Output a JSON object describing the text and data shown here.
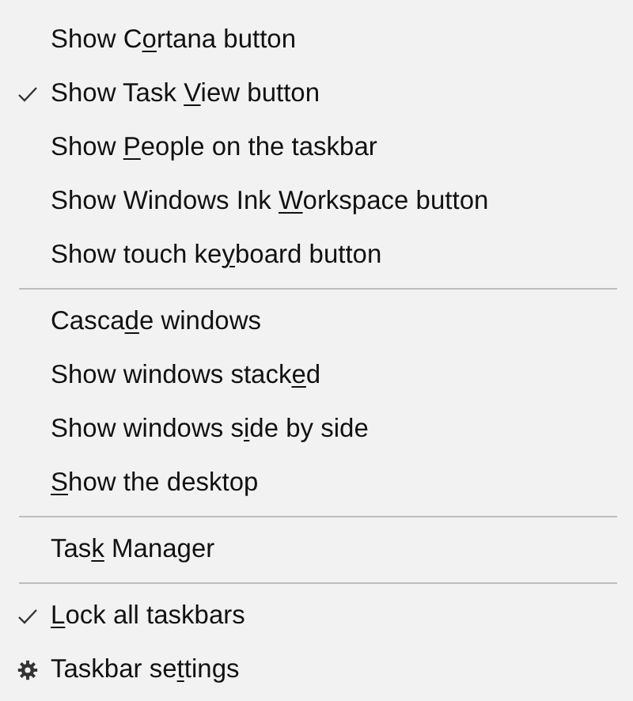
{
  "menu": {
    "entries": [
      {
        "kind": "item",
        "checked": false,
        "label": {
          "before": "Show C",
          "key": "o",
          "after": "rtana button"
        }
      },
      {
        "kind": "item",
        "checked": true,
        "label": {
          "before": "Show Task ",
          "key": "V",
          "after": "iew button"
        }
      },
      {
        "kind": "item",
        "checked": false,
        "label": {
          "before": "Show ",
          "key": "P",
          "after": "eople on the taskbar"
        }
      },
      {
        "kind": "item",
        "checked": false,
        "label": {
          "before": "Show Windows Ink ",
          "key": "W",
          "after": "orkspace button"
        }
      },
      {
        "kind": "item",
        "checked": false,
        "label": {
          "before": "Show touch ke",
          "key": "y",
          "after": "board button"
        }
      },
      {
        "kind": "separator"
      },
      {
        "kind": "item",
        "checked": false,
        "label": {
          "before": "Casca",
          "key": "d",
          "after": "e windows"
        }
      },
      {
        "kind": "item",
        "checked": false,
        "label": {
          "before": "Show windows stack",
          "key": "e",
          "after": "d"
        }
      },
      {
        "kind": "item",
        "checked": false,
        "label": {
          "before": "Show windows s",
          "key": "i",
          "after": "de by side"
        }
      },
      {
        "kind": "item",
        "checked": false,
        "label": {
          "key": "S",
          "after": "how the desktop"
        }
      },
      {
        "kind": "separator"
      },
      {
        "kind": "item",
        "checked": false,
        "label": {
          "before": "Tas",
          "key": "k",
          "after": " Manager"
        }
      },
      {
        "kind": "separator"
      },
      {
        "kind": "item",
        "checked": true,
        "label": {
          "key": "L",
          "after": "ock all taskbars"
        }
      },
      {
        "kind": "settings",
        "label": {
          "before": "Taskbar se",
          "key": "t",
          "after": "tings"
        }
      }
    ]
  }
}
